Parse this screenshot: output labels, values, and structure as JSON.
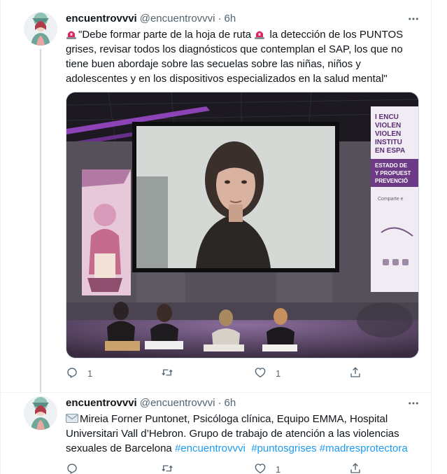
{
  "tweets": [
    {
      "author": {
        "name": "encuentrovvvi",
        "handle": "@encuentrovvvi",
        "separator": "·",
        "time": "6h"
      },
      "text": {
        "part1": "\"Debe formar parte de la hoja de ruta ",
        "part2": " la detección de los PUNTOS grises, revisar todos los diagnósticos que contemplan el SAP, los que no tiene buen abordaje sobre las secuelas sobre las niñas, niños y adolescentes y en los dispositivos especializados en la salud mental\""
      },
      "media": {
        "screen_sign_lines": [
          "I ENCU",
          "VIOLEN",
          "VIOLEN",
          "INSTITU",
          "EN ESPA",
          "ESTADO DE",
          "Y PROPUEST",
          "PREVENCIÓ",
          "Comparte e"
        ]
      },
      "actions": {
        "reply_count": "1",
        "retweet_count": "",
        "like_count": "1"
      }
    },
    {
      "author": {
        "name": "encuentrovvvi",
        "handle": "@encuentrovvvi",
        "separator": "·",
        "time": "6h"
      },
      "text": {
        "body": "Mireia Forner Puntonet, Psicóloga clínica, Equipo EMMA, Hospital Universitari Vall d’Hebron. Grupo de trabajo de atención a las violencias sexuales de Barcelona ",
        "hashtags": [
          "#encuentrovvvi",
          "#puntosgrises",
          "#madresprotectora"
        ]
      },
      "actions": {
        "reply_count": "",
        "retweet_count": "",
        "like_count": "1"
      }
    }
  ],
  "colors": {
    "text": "#0f1419",
    "secondary": "#536471",
    "link": "#1d9bf0",
    "border": "#eff3f4",
    "thread": "#cfd9de",
    "siren": "#e0245e"
  }
}
